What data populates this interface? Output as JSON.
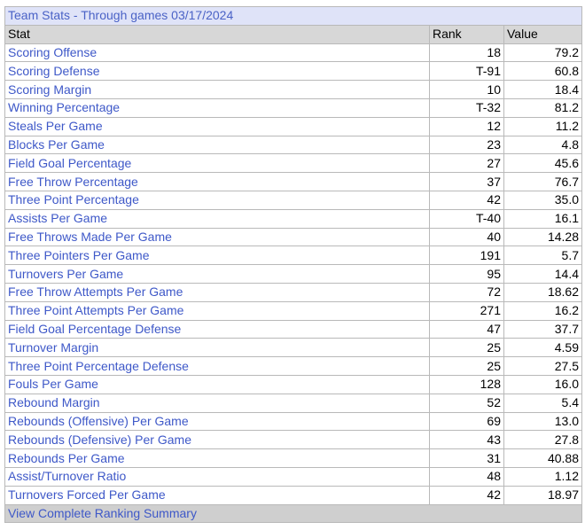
{
  "title": "Team Stats - Through games 03/17/2024",
  "headers": {
    "stat": "Stat",
    "rank": "Rank",
    "value": "Value"
  },
  "rows": [
    {
      "stat": "Scoring Offense",
      "rank": "18",
      "value": "79.2"
    },
    {
      "stat": "Scoring Defense",
      "rank": "T-91",
      "value": "60.8"
    },
    {
      "stat": "Scoring Margin",
      "rank": "10",
      "value": "18.4"
    },
    {
      "stat": "Winning Percentage",
      "rank": "T-32",
      "value": "81.2"
    },
    {
      "stat": "Steals Per Game",
      "rank": "12",
      "value": "11.2"
    },
    {
      "stat": "Blocks Per Game",
      "rank": "23",
      "value": "4.8"
    },
    {
      "stat": "Field Goal Percentage",
      "rank": "27",
      "value": "45.6"
    },
    {
      "stat": "Free Throw Percentage",
      "rank": "37",
      "value": "76.7"
    },
    {
      "stat": "Three Point Percentage",
      "rank": "42",
      "value": "35.0"
    },
    {
      "stat": "Assists Per Game",
      "rank": "T-40",
      "value": "16.1"
    },
    {
      "stat": "Free Throws Made Per Game",
      "rank": "40",
      "value": "14.28"
    },
    {
      "stat": "Three Pointers Per Game",
      "rank": "191",
      "value": "5.7"
    },
    {
      "stat": "Turnovers Per Game",
      "rank": "95",
      "value": "14.4"
    },
    {
      "stat": "Free Throw Attempts Per Game",
      "rank": "72",
      "value": "18.62"
    },
    {
      "stat": "Three Point Attempts Per Game",
      "rank": "271",
      "value": "16.2"
    },
    {
      "stat": "Field Goal Percentage Defense",
      "rank": "47",
      "value": "37.7"
    },
    {
      "stat": "Turnover Margin",
      "rank": "25",
      "value": "4.59"
    },
    {
      "stat": "Three Point Percentage Defense",
      "rank": "25",
      "value": "27.5"
    },
    {
      "stat": "Fouls Per Game",
      "rank": "128",
      "value": "16.0"
    },
    {
      "stat": "Rebound Margin",
      "rank": "52",
      "value": "5.4"
    },
    {
      "stat": "Rebounds (Offensive) Per Game",
      "rank": "69",
      "value": "13.0"
    },
    {
      "stat": "Rebounds (Defensive) Per Game",
      "rank": "43",
      "value": "27.8"
    },
    {
      "stat": "Rebounds Per Game",
      "rank": "31",
      "value": "40.88"
    },
    {
      "stat": "Assist/Turnover Ratio",
      "rank": "48",
      "value": "1.12"
    },
    {
      "stat": "Turnovers Forced Per Game",
      "rank": "42",
      "value": "18.97"
    }
  ],
  "footer_link": "View Complete Ranking Summary",
  "colors": {
    "link": "#3e58c8",
    "title_bg": "#dfe3f8",
    "header_bg": "#d7d7d7",
    "footer_bg": "#cfcfcf",
    "border": "#b9b9b9"
  }
}
